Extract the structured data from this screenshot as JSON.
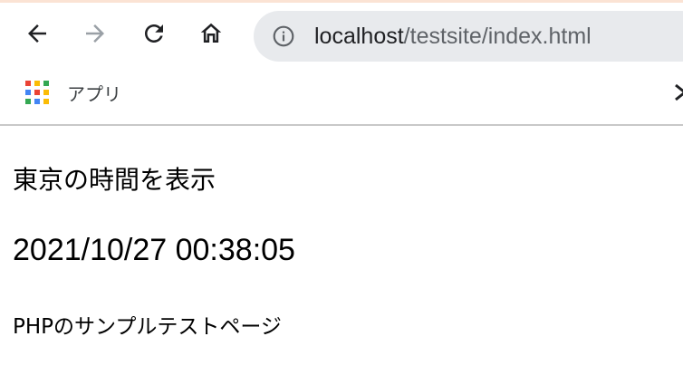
{
  "browser": {
    "url_host": "localhost",
    "url_path": "/testsite/index.html",
    "icons": {
      "back": "arrow-left-icon",
      "forward": "arrow-right-icon",
      "reload": "reload-icon",
      "home": "home-icon",
      "site_info": "info-icon"
    },
    "forward_enabled": false
  },
  "bookmarks_bar": {
    "apps_label": "アプリ",
    "apps_colors": [
      "#ea4335",
      "#fbbc05",
      "#34a853",
      "#4285f4",
      "#ea4335",
      "#fbbc05",
      "#34a853",
      "#4285f4",
      "#fbbc05"
    ]
  },
  "page": {
    "heading": "東京の時間を表示",
    "datetime": "2021/10/27 00:38:05",
    "footer": "PHPのサンプルテストページ"
  },
  "colors": {
    "accent_strip": "#fbe3d4",
    "omnibox_bg": "#e8eaed",
    "icon_active": "#202124",
    "icon_disabled": "#9aa0a6"
  }
}
